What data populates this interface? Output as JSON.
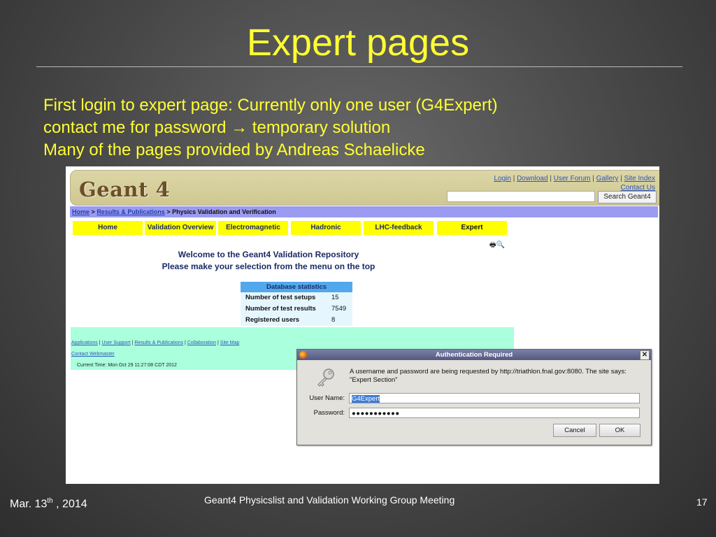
{
  "slide": {
    "title": "Expert pages",
    "bullets": [
      "First login to expert page: Currently only one user (G4Expert)",
      "contact me for password",
      "temporary solution",
      "Many of the pages provided by Andreas Schaelicke"
    ],
    "arrow": "→"
  },
  "site": {
    "logo": "Geant 4",
    "top_links": [
      "Login",
      "Download",
      "User Forum",
      "Gallery",
      "Site Index",
      "Contact Us"
    ],
    "search_button": "Search Geant4",
    "breadcrumb": [
      "Home",
      "Results & Publications",
      "Physics Validation and Verification"
    ],
    "breadcrumb_sep": ">",
    "nav": [
      "Home",
      "Validation Overview",
      "Electromagnetic",
      "Hadronic",
      "LHC-feedback",
      "Expert"
    ],
    "welcome_line1": "Welcome to the Geant4 Validation Repository",
    "welcome_line2": "Please make your selection from the menu on the top",
    "db_title": "Database statistics",
    "db_rows": [
      {
        "label": "Number of test setups",
        "value": "15"
      },
      {
        "label": "Number of test results",
        "value": "7549"
      },
      {
        "label": "Registered users",
        "value": "8"
      }
    ],
    "footer_links": [
      "Applications",
      "User Support",
      "Results & Publications",
      "Collaboration",
      "Site Map"
    ],
    "contact": "Contact Webmaster",
    "current_time": "Current Time: Mon Oct 29 11:27:08 CDT 2012"
  },
  "dialog": {
    "title": "Authentication Required",
    "message": "A username and password are being requested by http://triathlon.fnal.gov:8080. The site says: \"Expert Section\"",
    "username_label": "User Name:",
    "username_value": "G4Expert",
    "password_label": "Password:",
    "password_value": "●●●●●●●●●●●",
    "cancel": "Cancel",
    "ok": "OK"
  },
  "footer": {
    "date_prefix": "Mar. 13",
    "date_sup": "th",
    "date_suffix": " , 2014",
    "meeting": "Geant4 Physicslist and Validation Working Group Meeting",
    "page_number": "17"
  }
}
